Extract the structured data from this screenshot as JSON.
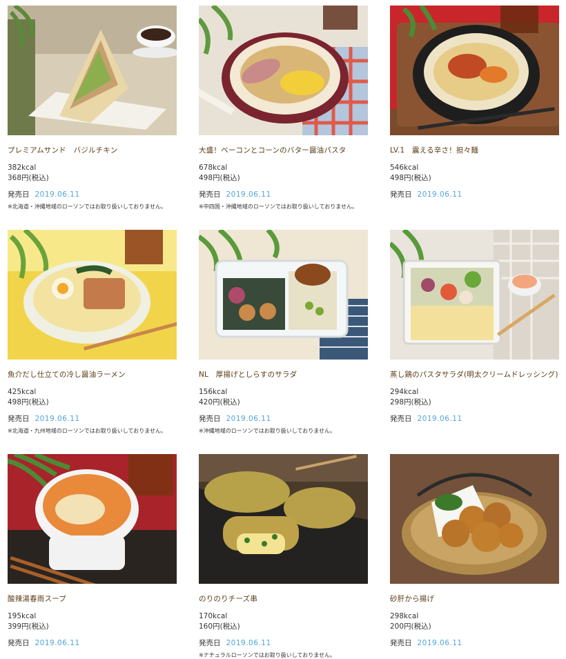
{
  "products": [
    {
      "name": "プレミアムサンド　バジルチキン",
      "kcal": "382kcal",
      "price": "368円(税込)",
      "release_label": "発売日",
      "release_date": "2019.06.11",
      "note": "※北海道・沖縄地域のローソンではお取り扱いしておりません。",
      "image_icon": "sandwich-photo"
    },
    {
      "name": "大盛！ベーコンとコーンのバター醤油パスタ",
      "kcal": "678kcal",
      "price": "498円(税込)",
      "release_label": "発売日",
      "release_date": "2019.06.11",
      "note": "※中四国・沖縄地域のローソンではお取り扱いしておりません。",
      "image_icon": "pasta-photo"
    },
    {
      "name": "LV.1　震える辛さ！担々麺",
      "kcal": "546kcal",
      "price": "498円(税込)",
      "release_label": "発売日",
      "release_date": "2019.06.11",
      "note": "",
      "image_icon": "tantanmen-photo"
    },
    {
      "name": "魚介だし仕立ての冷し醤油ラーメン",
      "kcal": "425kcal",
      "price": "498円(税込)",
      "release_label": "発売日",
      "release_date": "2019.06.11",
      "note": "※北海道・九州地域のローソンではお取り扱いしておりません。",
      "image_icon": "ramen-photo"
    },
    {
      "name": "NL　厚揚げとしらすのサラダ",
      "kcal": "156kcal",
      "price": "420円(税込)",
      "release_label": "発売日",
      "release_date": "2019.06.11",
      "note": "※沖縄地域のローソンではお取り扱いしておりません。",
      "image_icon": "salad-box-photo"
    },
    {
      "name": "蒸し鶏のパスタサラダ(明太クリームドレッシング)",
      "kcal": "294kcal",
      "price": "298円(税込)",
      "release_label": "発売日",
      "release_date": "2019.06.11",
      "note": "",
      "image_icon": "pasta-salad-photo"
    },
    {
      "name": "酸辣湯春雨スープ",
      "kcal": "195kcal",
      "price": "399円(税込)",
      "release_label": "発売日",
      "release_date": "2019.06.11",
      "note": "",
      "image_icon": "soup-photo"
    },
    {
      "name": "のりのりチーズ串",
      "kcal": "170kcal",
      "price": "160円(税込)",
      "release_label": "発売日",
      "release_date": "2019.06.11",
      "note": "※ナチュラルローソンではお取り扱いしておりません。",
      "image_icon": "cheese-skewer-photo"
    },
    {
      "name": "砂肝から揚げ",
      "kcal": "298kcal",
      "price": "200円(税込)",
      "release_label": "発売日",
      "release_date": "2019.06.11",
      "note": "",
      "image_icon": "karaage-photo"
    }
  ],
  "colors": {
    "name_text": "#5a3a14",
    "date_text": "#4fa3d9",
    "body_text": "#333333"
  }
}
